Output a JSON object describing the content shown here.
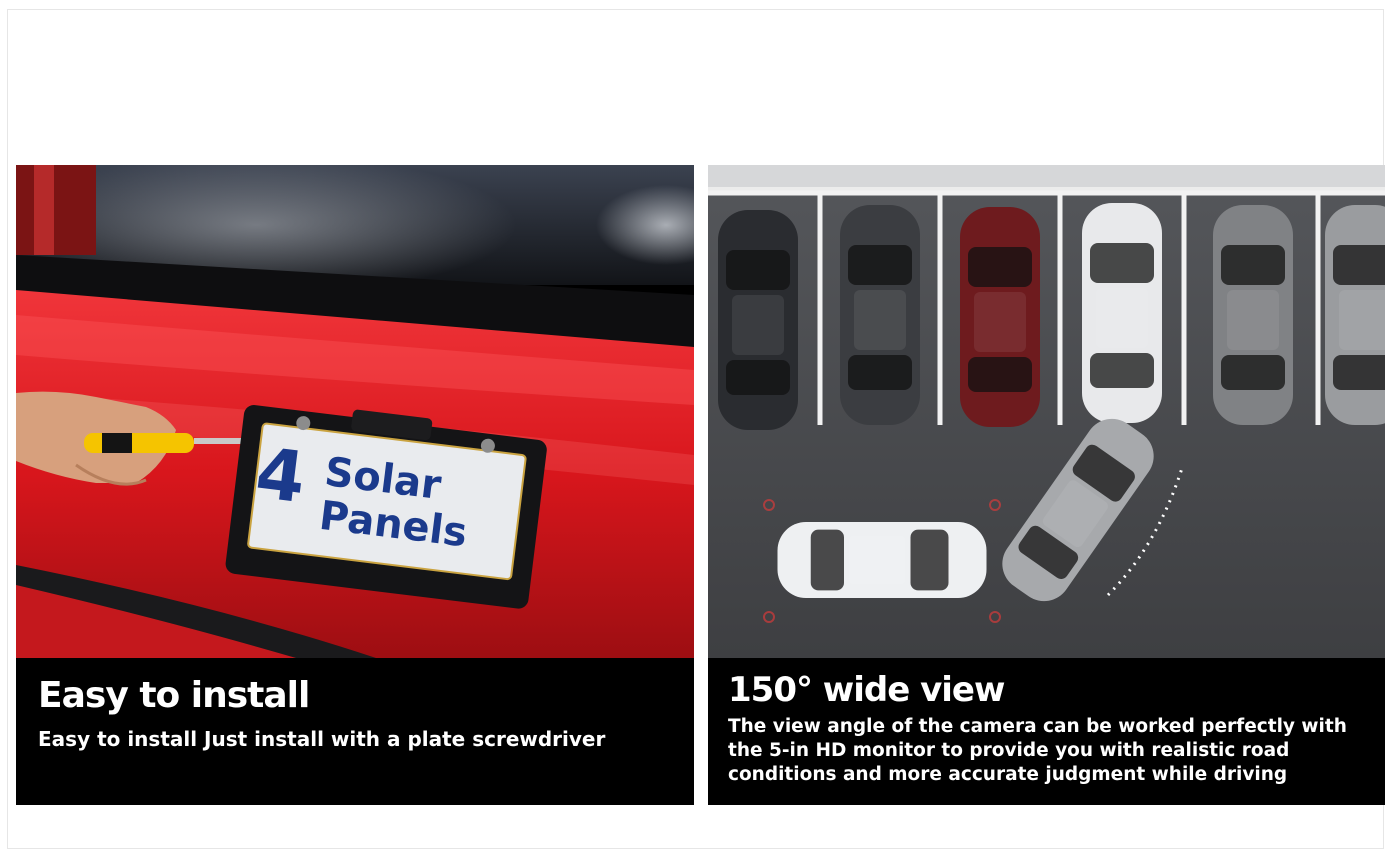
{
  "left_panel": {
    "plate_number": "4",
    "plate_line1": "Solar",
    "plate_line2": "Panels",
    "title": "Easy to install",
    "description": "Easy to install Just install with a plate screwdriver"
  },
  "right_panel": {
    "title": "150° wide view",
    "description": "The view angle of the camera can be worked perfectly with the 5-in HD monitor to provide you with realistic road conditions and more accurate judgment while driving"
  },
  "colors": {
    "car_red": "#e01c22",
    "plate_text_blue": "#1b3a8c",
    "screwdriver_yellow": "#f5c400",
    "asphalt": "#4a4b4e",
    "caption_bg": "#000000"
  }
}
